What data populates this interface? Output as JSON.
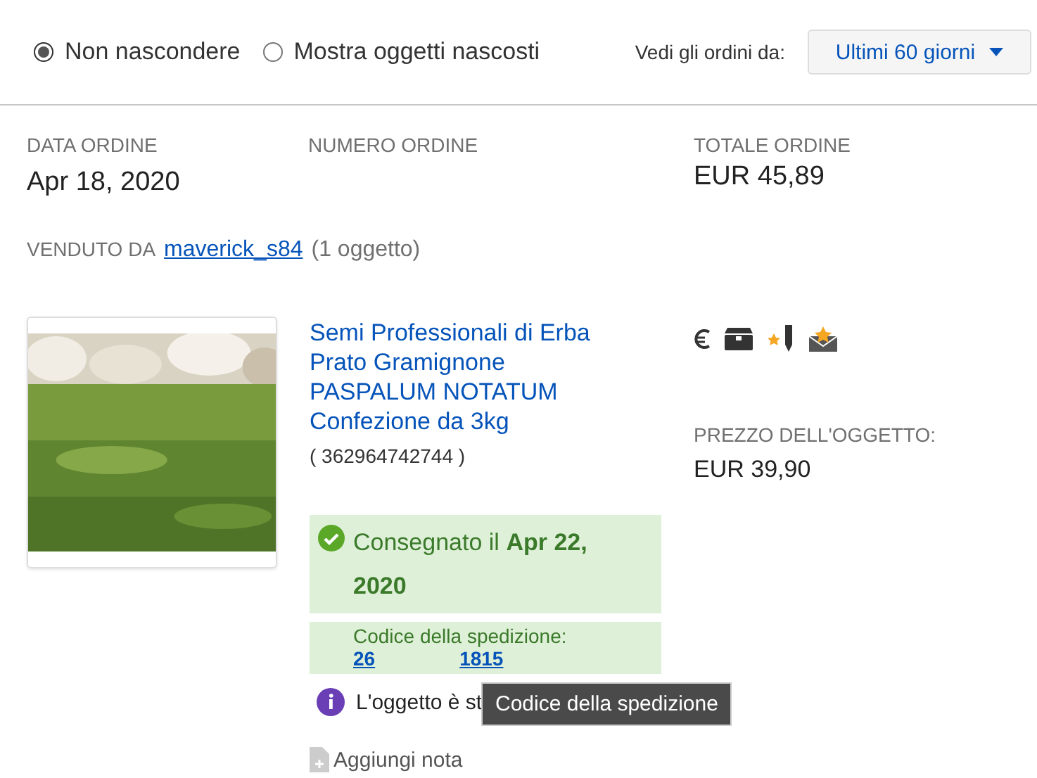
{
  "filters": [
    {
      "label": "Non nascondere",
      "selected": true
    },
    {
      "label": "Mostra oggetti nascosti",
      "selected": false
    }
  ],
  "period": {
    "label": "Vedi gli ordini da:",
    "value": "Ultimi 60 giorni"
  },
  "order": {
    "date_label": "DATA ORDINE",
    "date": "Apr 18, 2020",
    "number_label": "NUMERO ORDINE",
    "total_label": "TOTALE ORDINE",
    "total": "EUR 45,89"
  },
  "seller": {
    "label": "VENDUTO DA",
    "name": "maverick_s84",
    "count": "(1 oggetto)"
  },
  "item": {
    "title": "Semi Professionali di Erba Prato Gramignone PASPALUM NOTATUM Confezione da 3kg",
    "id": "( 362964742744 )",
    "price_label": "PREZZO DELL'OGGETTO:",
    "price": "EUR 39,90",
    "delivery": "Consegnato il **Apr 22, 2020**",
    "tracking_label": "Codice della spedizione:",
    "tracking_start": "26",
    "tracking_end": "1815",
    "info": "L'oggetto è st",
    "tooltip": "Codice della spedizione",
    "note": "Aggiungi nota"
  }
}
